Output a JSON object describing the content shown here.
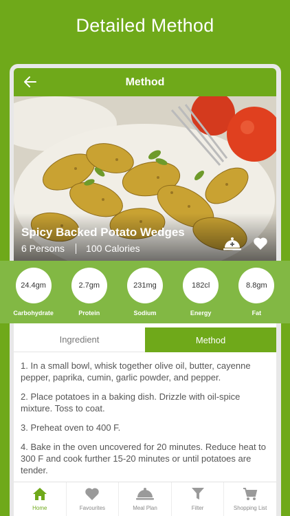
{
  "hero": {
    "title": "Detailed Method"
  },
  "topbar": {
    "title": "Method",
    "back_icon": "arrow-left-icon"
  },
  "recipe": {
    "name": "Spicy Backed Potato Wedges",
    "servings": "6 Persons",
    "calories": "100 Calories"
  },
  "nutrition": [
    {
      "value": "24.4gm",
      "label": "Carbohydrate"
    },
    {
      "value": "2.7gm",
      "label": "Protein"
    },
    {
      "value": "231mg",
      "label": "Sodium"
    },
    {
      "value": "182cl",
      "label": "Energy"
    },
    {
      "value": "8.8gm",
      "label": "Fat"
    }
  ],
  "tabs": [
    {
      "label": "Ingredient",
      "active": false
    },
    {
      "label": "Method",
      "active": true
    }
  ],
  "steps": [
    "1. In a small bowl, whisk together olive oil, butter, cayenne pepper, paprika, cumin, garlic powder, and pepper.",
    "2. Place potatoes in a baking dish. Drizzle with oil-spice mixture. Toss to coat.",
    "3. Preheat oven to 400 F.",
    "4. Bake in the oven uncovered for 20 minutes. Reduce heat to 300 F and cook further 15-20 minutes or until potatoes are tender."
  ],
  "bottom_nav": [
    {
      "label": "Home",
      "icon": "home-icon",
      "active": true
    },
    {
      "label": "Favourites",
      "icon": "heart-icon",
      "active": false
    },
    {
      "label": "Meal Plan",
      "icon": "cloche-icon",
      "active": false
    },
    {
      "label": "Filter",
      "icon": "filter-icon",
      "active": false
    },
    {
      "label": "Shopping List",
      "icon": "cart-icon",
      "active": false
    }
  ],
  "colors": {
    "brand_green": "#6fa91a",
    "nutrition_green": "#82b844"
  }
}
